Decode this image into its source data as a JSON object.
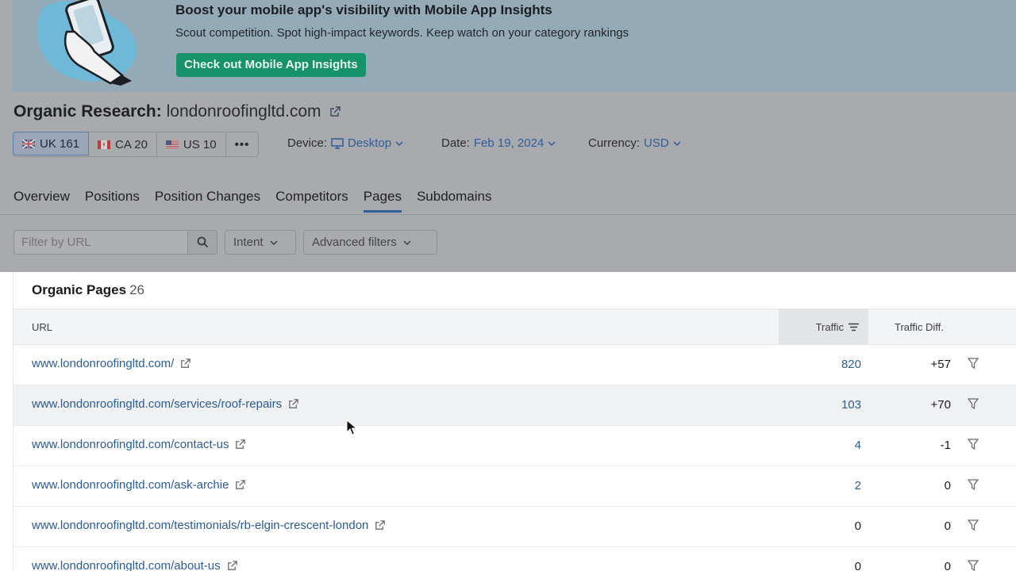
{
  "banner": {
    "title": "Boost your mobile app's visibility with Mobile App Insights",
    "subtitle": "Scout competition. Spot high-impact keywords. Keep watch on your category rankings",
    "cta": "Check out Mobile App Insights"
  },
  "header": {
    "title": "Organic Research:",
    "domain": "londonroofingltd.com"
  },
  "databases": [
    {
      "label": "UK 161",
      "flag": "uk-flag-icon"
    },
    {
      "label": "CA 20",
      "flag": "ca-flag-icon"
    },
    {
      "label": "US 10",
      "flag": "us-flag-icon"
    }
  ],
  "more_label": "•••",
  "device": {
    "label": "Device:",
    "value": "Desktop"
  },
  "date": {
    "label": "Date:",
    "value": "Feb 19, 2024"
  },
  "currency": {
    "label": "Currency:",
    "value": "USD"
  },
  "tabs": [
    "Overview",
    "Positions",
    "Position Changes",
    "Competitors",
    "Pages",
    "Subdomains"
  ],
  "active_tab": "Pages",
  "filters": {
    "url_placeholder": "Filter by URL",
    "intent": "Intent",
    "advanced": "Advanced filters"
  },
  "table": {
    "title": "Organic Pages",
    "count": "26",
    "col_url": "URL",
    "col_traffic": "Traffic",
    "col_diff": "Traffic Diff.",
    "rows": [
      {
        "url": "www.londonroofingltd.com/",
        "traffic": "820",
        "diff": "+57"
      },
      {
        "url": "www.londonroofingltd.com/services/roof-repairs",
        "traffic": "103",
        "diff": "+70"
      },
      {
        "url": "www.londonroofingltd.com/contact-us",
        "traffic": "4",
        "diff": "-1"
      },
      {
        "url": "www.londonroofingltd.com/ask-archie",
        "traffic": "2",
        "diff": "0"
      },
      {
        "url": "www.londonroofingltd.com/testimonials/rb-elgin-crescent-london",
        "traffic": "0",
        "diff": "0"
      },
      {
        "url": "www.londonroofingltd.com/about-us",
        "traffic": "0",
        "diff": "0"
      }
    ]
  },
  "colors": {
    "link": "#2b5b98",
    "cta": "#17936c",
    "banner": "#95aab7",
    "overlay": "#a9aaae"
  }
}
